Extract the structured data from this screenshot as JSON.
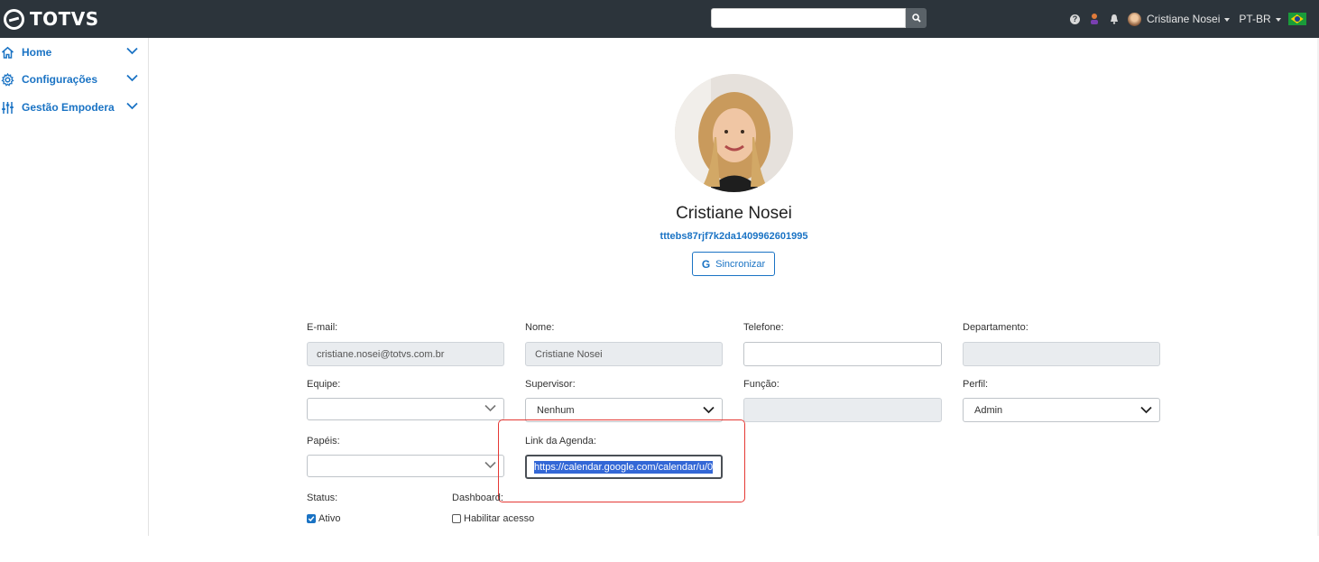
{
  "header": {
    "brand": "TOTVS",
    "search_placeholder": "",
    "user_name": "Cristiane Nosei",
    "language": "PT-BR"
  },
  "sidebar": {
    "items": [
      {
        "label": "Home",
        "icon": "home-icon"
      },
      {
        "label": "Configurações",
        "icon": "gear-icon"
      },
      {
        "label": "Gestão Empodera",
        "icon": "sliders-icon"
      }
    ]
  },
  "profile": {
    "name": "Cristiane Nosei",
    "id": "tttebs87rjf7k2da1409962601995",
    "sync_label": "Sincronizar",
    "sync_icon_letter": "G"
  },
  "form": {
    "email_label": "E-mail:",
    "email_value": "cristiane.nosei@totvs.com.br",
    "nome_label": "Nome:",
    "nome_value": "Cristiane Nosei",
    "telefone_label": "Telefone:",
    "telefone_value": "",
    "departamento_label": "Departamento:",
    "departamento_value": "",
    "equipe_label": "Equipe:",
    "equipe_value": "",
    "supervisor_label": "Supervisor:",
    "supervisor_value": "Nenhum",
    "funcao_label": "Função:",
    "funcao_value": "",
    "perfil_label": "Perfil:",
    "perfil_value": "Admin",
    "papeis_label": "Papéis:",
    "papeis_value": "",
    "link_label": "Link da Agenda:",
    "link_value": "https://calendar.google.com/calendar/u/0",
    "status_label": "Status:",
    "status_option": "Ativo",
    "status_checked": true,
    "dashboard_label": "Dashboard:",
    "dashboard_option": "Habilitar acesso",
    "dashboard_checked": false
  },
  "colors": {
    "topbar": "#2c343b",
    "accent": "#1a73c4",
    "highlight": "#e53935"
  }
}
